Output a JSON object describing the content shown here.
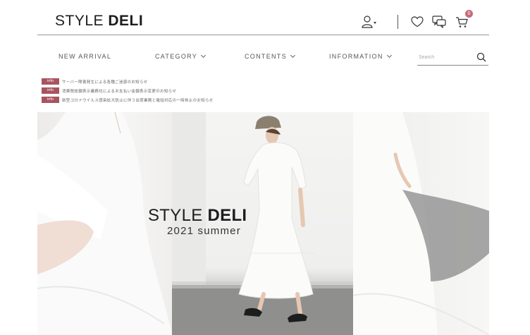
{
  "header": {
    "logo_light": "STYLE ",
    "logo_bold": "DELI",
    "icons": [
      "user-icon",
      "heart-icon",
      "chat-icon",
      "cart-icon"
    ],
    "cart_count": "0"
  },
  "nav": {
    "items": [
      {
        "label": "NEW ARRIVAL"
      },
      {
        "label": "CATEGORY"
      },
      {
        "label": "CONTENTS"
      },
      {
        "label": "INFORMATION"
      }
    ],
    "search_placeholder": "Search"
  },
  "info": {
    "badge": "info",
    "items": [
      "サーバー障害発生による各種ご迷惑のお知らせ",
      "消費税総額表示義務化によるお支払い金額表示変更のお知らせ",
      "新型コロナウイルス感染拡大防止に伴う出荷業務と電話対応の一時休止のお知らせ"
    ]
  },
  "hero": {
    "title_light": "STYLE ",
    "title_bold": "DELI",
    "subtitle": "2021 summer"
  },
  "colors": {
    "accent": "#a85460",
    "badge": "#c66b78",
    "text": "#222222"
  }
}
